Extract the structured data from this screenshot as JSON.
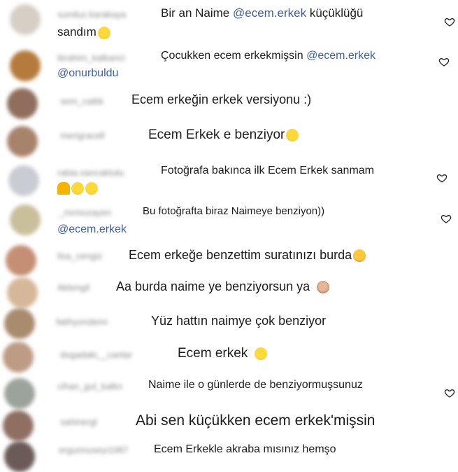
{
  "comments": [
    {
      "user": "sunduz.karakaya",
      "text": "Bir an Naime ",
      "mention": "@ecem.erkek",
      "rest": " küçüklüğü",
      "line2": "sandım",
      "emoji": "grinning-sweat",
      "heart": true
    },
    {
      "user": "ibrahim_kalkanci",
      "text": "Çocukken ecem erkekmişsin ",
      "mention": "@ecem.erkek",
      "line2mention": "@onurbuldu",
      "heart": true
    },
    {
      "user": "sem_catkk",
      "text": "Ecem erkeğin erkek versiyonu :)",
      "heart": false
    },
    {
      "user": "merigracell",
      "text": "Ecem Erkek e benziyor",
      "emoji": "grinning-sweat",
      "heart": false
    },
    {
      "user": "rabia.sancaktutu",
      "text": "Fotoğrafa bakınca ilk Ecem Erkek sanmam",
      "emojis": [
        "person",
        "grin-sweat",
        "grin-sweat"
      ],
      "heart": true
    },
    {
      "user": "_mrmozayen",
      "text": "Bu fotoğrafta biraz Naimeye benziyon))",
      "line2mention": "@ecem.erkek",
      "heart": true
    },
    {
      "user": "lisa_cengiz",
      "text": "Ecem erkeğe benzettim suratınızı burda",
      "emoji": "smiling-hearts",
      "heart": false
    },
    {
      "user": "Aktengil",
      "text": "Aa burda naime ye benziyorsun ya",
      "emoji": "see-no-evil",
      "heart": false
    },
    {
      "user": "fatihyondemi",
      "text": "Yüz hattın naimye çok benziyor",
      "heart": false
    },
    {
      "user": "dogadaki__cantar",
      "text": "Ecem erkek",
      "emoji": "astonished",
      "heart": false
    },
    {
      "user": "cihan_gul_kalkn",
      "text": "Naime ile o günlerde de benziyormuşsunuz",
      "heart": true
    },
    {
      "user": "sahinergl",
      "text": "Abi sen küçükken ecem erkek'mişsin",
      "heart": false
    },
    {
      "user": "ergunnuseyi1987",
      "text": "Ecem Erkekle akraba mısınız hemşo",
      "heart": false
    }
  ],
  "colors": {
    "mention": "#3b5ea8",
    "text": "#1c1c1c",
    "username": "#8a8a8a",
    "background": "#ffffff"
  },
  "icons": {
    "like": "heart-outline-icon"
  }
}
